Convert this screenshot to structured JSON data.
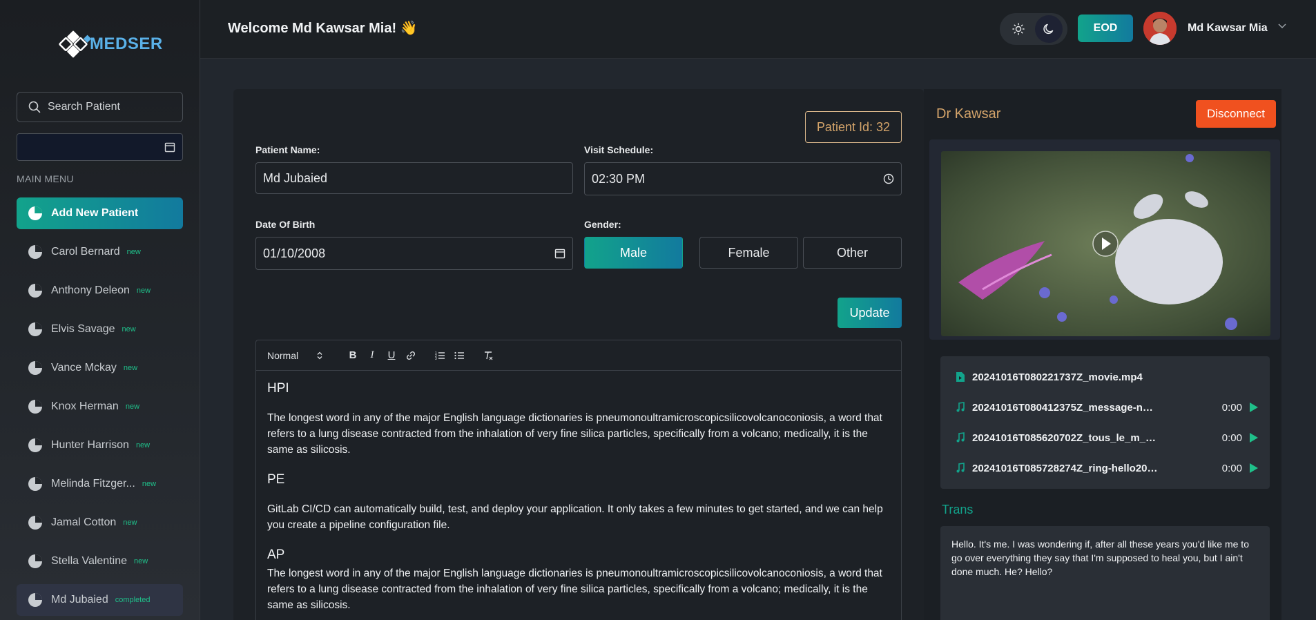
{
  "brand": {
    "logo_text": "MEDSER"
  },
  "search": {
    "placeholder": "Search Patient"
  },
  "sidebar": {
    "menu_label": "MAIN MENU",
    "items": [
      {
        "label": "Add New Patient",
        "badge": ""
      },
      {
        "label": "Carol Bernard",
        "badge": "new"
      },
      {
        "label": "Anthony Deleon",
        "badge": "new"
      },
      {
        "label": "Elvis Savage",
        "badge": "new"
      },
      {
        "label": "Vance Mckay",
        "badge": "new"
      },
      {
        "label": "Knox Herman",
        "badge": "new"
      },
      {
        "label": "Hunter Harrison",
        "badge": "new"
      },
      {
        "label": "Melinda Fitzger...",
        "badge": "new"
      },
      {
        "label": "Jamal Cotton",
        "badge": "new"
      },
      {
        "label": "Stella Valentine",
        "badge": "new"
      },
      {
        "label": "Md Jubaied",
        "badge": "completed"
      }
    ]
  },
  "header": {
    "welcome": "Welcome Md Kawsar Mia! 👋",
    "eod_label": "EOD",
    "user_name": "Md Kawsar Mia"
  },
  "form": {
    "patient_id": "Patient Id: 32",
    "patient_name_label": "Patient Name:",
    "patient_name_value": "Md Jubaied",
    "visit_label": "Visit Schedule:",
    "visit_value": "02:30 PM",
    "dob_label": "Date Of Birth",
    "dob_value": "01/10/2008",
    "gender_label": "Gender:",
    "gender_options": [
      "Male",
      "Female",
      "Other"
    ],
    "gender_selected": "Male",
    "update_label": "Update"
  },
  "editor": {
    "format_select": "Normal",
    "sections": [
      {
        "heading": "HPI",
        "text": "The longest word in any of the major English language dictionaries is pneumonoultramicroscopicsilicovolcanoconiosis, a word that refers to a lung disease contracted from the inhalation of very fine silica particles, specifically from a volcano; medically, it is the same as silicosis."
      },
      {
        "heading": "PE",
        "text": "GitLab CI/CD can automatically build, test, and deploy your application. It only takes a few minutes to get started, and we can help you create a pipeline configuration file."
      },
      {
        "heading": "AP",
        "text": "The longest word in any of the major English language dictionaries is pneumonoultramicroscopicsilicovolcanoconiosis, a word that refers to a lung disease contracted from the inhalation of very fine silica particles, specifically from a volcano; medically, it is the same as silicosis."
      }
    ]
  },
  "call": {
    "doctor_name": "Dr Kawsar",
    "disconnect_label": "Disconnect",
    "files": [
      {
        "name": "20241016T080221737Z_movie.mp4",
        "type": "video",
        "time": ""
      },
      {
        "name": "20241016T080412375Z_message-not...",
        "type": "audio",
        "time": "0:00"
      },
      {
        "name": "20241016T085620702Z_tous_le_m_m...",
        "type": "audio",
        "time": "0:00"
      },
      {
        "name": "20241016T085728274Z_ring-hello201...",
        "type": "audio",
        "time": "0:00"
      }
    ],
    "trans_title": "Trans",
    "transcript": "Hello. It's me. I was wondering if, after all these years you'd like me to go over everything they say that I'm supposed to heal you, but I ain't done much. He? Hello?"
  },
  "colors": {
    "accent": "#12a38b",
    "accent2": "#127a9e",
    "danger": "#f0511f",
    "gold": "#d4a46a"
  }
}
